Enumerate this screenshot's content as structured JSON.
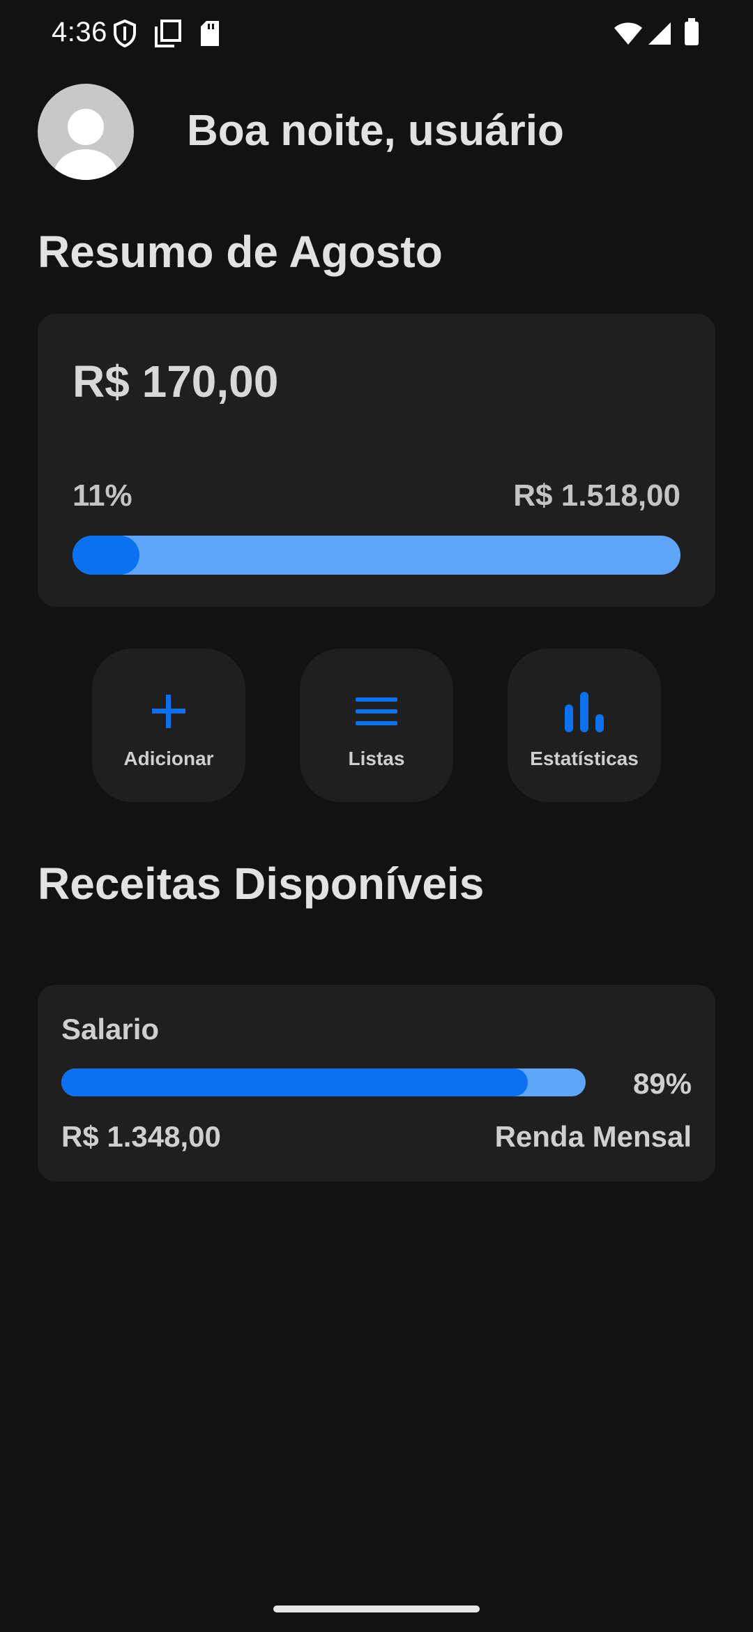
{
  "status_bar": {
    "time": "4:36",
    "icons": [
      "shield-icon",
      "copy-icon",
      "sd-card-icon",
      "wifi-icon",
      "signal-icon",
      "battery-icon"
    ]
  },
  "header": {
    "greeting": "Boa noite, usuário",
    "avatar_icon": "user-avatar-icon"
  },
  "summary": {
    "title": "Resumo de Agosto",
    "amount": "R$ 170,00",
    "percent_label": "11%",
    "percent_value": 0.11,
    "limit": "R$ 1.518,00"
  },
  "actions": [
    {
      "label": "Adicionar",
      "icon": "plus-icon"
    },
    {
      "label": "Listas",
      "icon": "menu-lines-icon"
    },
    {
      "label": "Estatísticas",
      "icon": "bar-chart-icon"
    }
  ],
  "incomes": {
    "title": "Receitas Disponíveis",
    "items": [
      {
        "name": "Salario",
        "percent_label": "89%",
        "percent_value": 0.89,
        "amount": "R$ 1.348,00",
        "type": "Renda Mensal"
      }
    ]
  },
  "colors": {
    "background": "#121212",
    "card": "#1f1f1f",
    "accent": "#0a72f0",
    "accent_light": "#5ea6fb"
  }
}
